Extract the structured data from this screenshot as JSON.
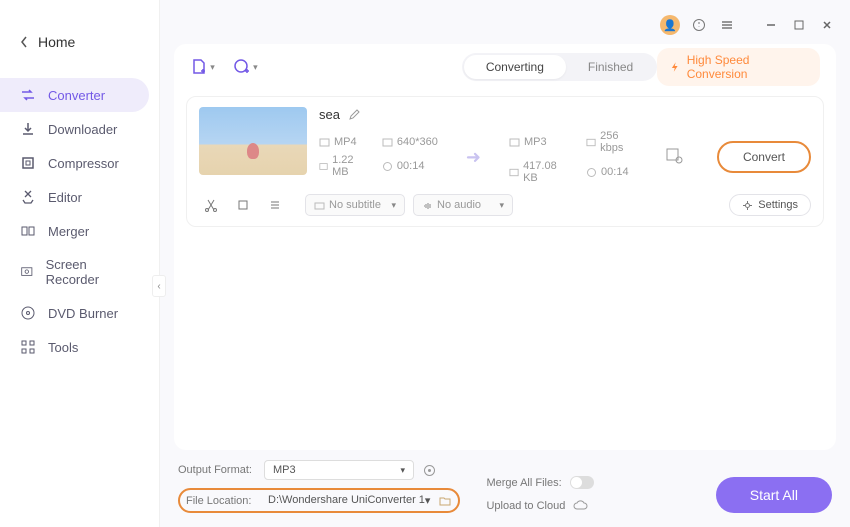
{
  "home_label": "Home",
  "sidebar": {
    "items": [
      {
        "label": "Converter"
      },
      {
        "label": "Downloader"
      },
      {
        "label": "Compressor"
      },
      {
        "label": "Editor"
      },
      {
        "label": "Merger"
      },
      {
        "label": "Screen Recorder"
      },
      {
        "label": "DVD Burner"
      },
      {
        "label": "Tools"
      }
    ]
  },
  "tabs": {
    "converting": "Converting",
    "finished": "Finished"
  },
  "high_speed": "High Speed Conversion",
  "item": {
    "title": "sea",
    "src": {
      "format": "MP4",
      "dim": "640*360",
      "size": "1.22 MB",
      "duration": "00:14"
    },
    "dst": {
      "format": "MP3",
      "bitrate": "256 kbps",
      "size": "417.08 KB",
      "duration": "00:14"
    },
    "subtitle_sel": "No subtitle",
    "audio_sel": "No audio",
    "settings_label": "Settings",
    "convert_label": "Convert"
  },
  "bottom": {
    "output_format_label": "Output Format:",
    "output_format_value": "MP3",
    "file_location_label": "File Location:",
    "file_location_value": "D:\\Wondershare UniConverter 1",
    "merge_label": "Merge All Files:",
    "upload_label": "Upload to Cloud",
    "start_all": "Start All"
  }
}
